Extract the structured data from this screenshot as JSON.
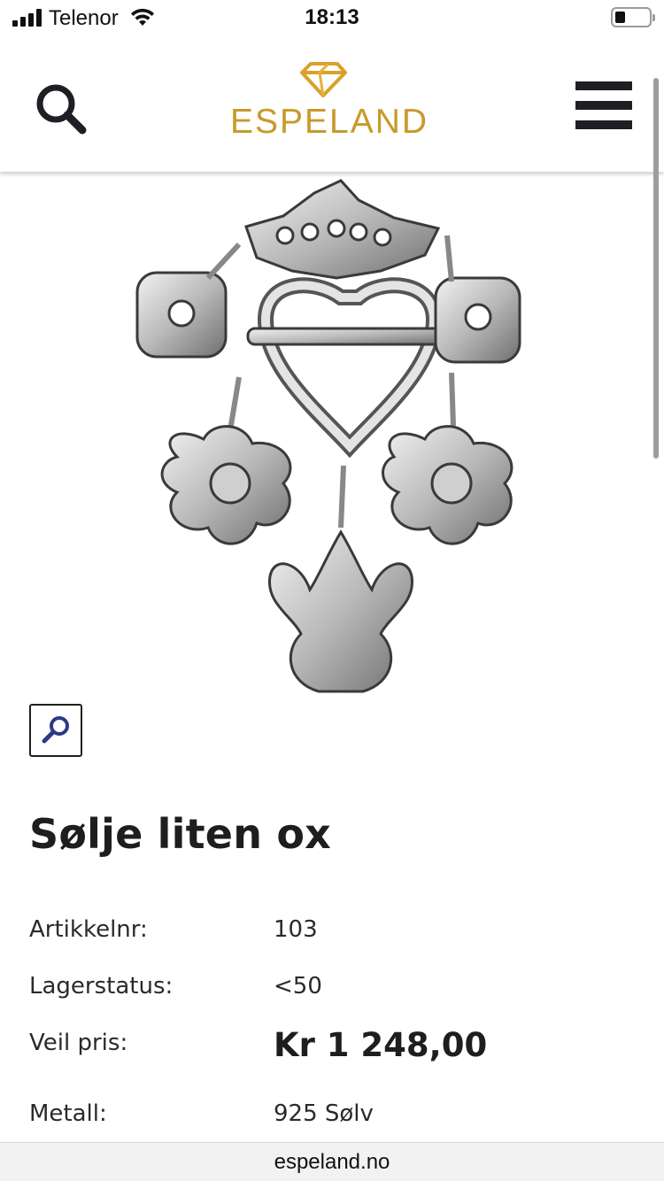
{
  "status_bar": {
    "carrier": "Telenor",
    "time": "18:13",
    "battery_level_fraction": 0.25
  },
  "header": {
    "logo_text": "ESPELAND",
    "brand_color": "#c79a2a",
    "search_icon": "search-icon",
    "menu_icon": "hamburger-menu-icon"
  },
  "product": {
    "image_description_icon": "brooch-image",
    "zoom_icon": "zoom-magnifier-icon",
    "title": "Sølje liten ox",
    "specs": {
      "article_label": "Artikkelnr:",
      "article_value": "103",
      "stock_label": "Lagerstatus:",
      "stock_value": "<50",
      "price_label": "Veil pris:",
      "price_value": "Kr 1 248,00",
      "metal_label": "Metall:",
      "metal_value": "925 Sølv"
    }
  },
  "browser": {
    "url": "espeland.no"
  }
}
